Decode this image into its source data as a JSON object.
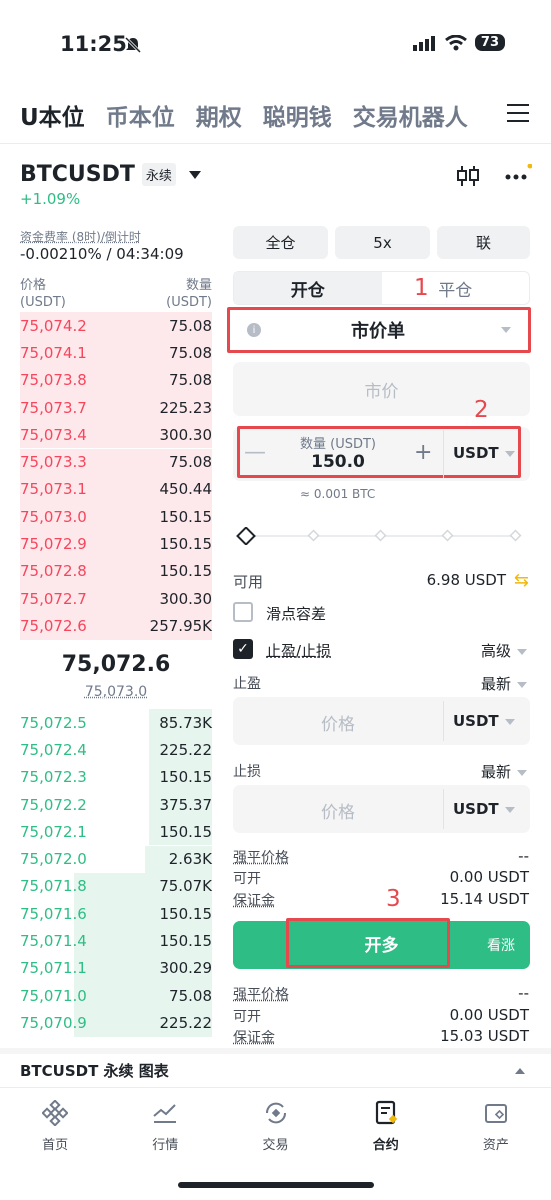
{
  "status": {
    "time": "11:25",
    "battery": "73"
  },
  "top_tabs": [
    "U本位",
    "币本位",
    "期权",
    "聪明钱",
    "交易机器人"
  ],
  "symbol": {
    "name": "BTCUSDT",
    "tag": "永续",
    "change": "+1.09%"
  },
  "funding": {
    "label": "资金费率 (8时)/倒计时",
    "value": "-0.00210% / 04:34:09"
  },
  "orderbook": {
    "price_header": "价格",
    "price_unit": "(USDT)",
    "qty_header": "数量",
    "qty_unit": "(USDT)",
    "asks": [
      {
        "price": "75,074.2",
        "qty": "75.08",
        "depth": 1.0
      },
      {
        "price": "75,074.1",
        "qty": "75.08",
        "depth": 1.0
      },
      {
        "price": "75,073.8",
        "qty": "75.08",
        "depth": 1.0
      },
      {
        "price": "75,073.7",
        "qty": "225.23",
        "depth": 1.0
      },
      {
        "price": "75,073.4",
        "qty": "300.30",
        "depth": 1.0
      },
      {
        "price": "75,073.3",
        "qty": "75.08",
        "depth": 1.0
      },
      {
        "price": "75,073.1",
        "qty": "450.44",
        "depth": 1.0
      },
      {
        "price": "75,073.0",
        "qty": "150.15",
        "depth": 1.0
      },
      {
        "price": "75,072.9",
        "qty": "150.15",
        "depth": 1.0
      },
      {
        "price": "75,072.8",
        "qty": "150.15",
        "depth": 1.0
      },
      {
        "price": "75,072.7",
        "qty": "300.30",
        "depth": 1.0
      },
      {
        "price": "75,072.6",
        "qty": "257.95K",
        "depth": 1.0
      }
    ],
    "mid_price": "75,072.6",
    "mark_price": "75,073.0",
    "bids": [
      {
        "price": "75,072.5",
        "qty": "85.73K",
        "depth": 0.33
      },
      {
        "price": "75,072.4",
        "qty": "225.22",
        "depth": 0.33
      },
      {
        "price": "75,072.3",
        "qty": "150.15",
        "depth": 0.33
      },
      {
        "price": "75,072.2",
        "qty": "375.37",
        "depth": 0.33
      },
      {
        "price": "75,072.1",
        "qty": "150.15",
        "depth": 0.33
      },
      {
        "price": "75,072.0",
        "qty": "2.63K",
        "depth": 0.35
      },
      {
        "price": "75,071.8",
        "qty": "75.07K",
        "depth": 0.72
      },
      {
        "price": "75,071.6",
        "qty": "150.15",
        "depth": 0.72
      },
      {
        "price": "75,071.4",
        "qty": "150.15",
        "depth": 0.72
      },
      {
        "price": "75,071.1",
        "qty": "300.29",
        "depth": 0.72
      },
      {
        "price": "75,071.0",
        "qty": "75.08",
        "depth": 0.72
      },
      {
        "price": "75,070.9",
        "qty": "225.22",
        "depth": 0.72
      }
    ]
  },
  "margin_buttons": {
    "cross": "全仓",
    "leverage": "5x",
    "mode": "联"
  },
  "position_tabs": {
    "open": "开仓",
    "close": "平仓"
  },
  "annotations": [
    "1",
    "2",
    "3"
  ],
  "order_type": "市价单",
  "market_price": "市价",
  "quantity": {
    "label": "数量 (USDT)",
    "value": "150.0",
    "unit": "USDT",
    "minus": "—",
    "plus": "+",
    "approx": "≈ 0.001 BTC"
  },
  "available": {
    "label": "可用",
    "value": "6.98 USDT"
  },
  "slippage": "滑点容差",
  "tpsl": {
    "label": "止盈/止损",
    "advanced": "高级"
  },
  "take_profit": {
    "label": "止盈",
    "mode": "最新",
    "placeholder": "价格",
    "unit": "USDT"
  },
  "stop_loss": {
    "label": "止损",
    "mode": "最新",
    "placeholder": "价格",
    "unit": "USDT"
  },
  "summary1": {
    "liq_label": "强平价格",
    "liq_value": "--",
    "open_label": "可开",
    "open_value": "0.00 USDT",
    "margin_label": "保证金",
    "margin_value": "15.14 USDT"
  },
  "long_button": {
    "label": "开多",
    "hint": "看涨"
  },
  "summary2": {
    "liq_label": "强平价格",
    "liq_value": "--",
    "open_label": "可开",
    "open_value": "0.00 USDT",
    "margin_label": "保证金",
    "margin_value": "15.03 USDT"
  },
  "chart_bar": "BTCUSDT 永续 图表",
  "nav": [
    "首页",
    "行情",
    "交易",
    "合约",
    "资产"
  ],
  "colors": {
    "green": "#2ebd85",
    "red": "#f6465d",
    "annotation": "#e5484d",
    "yellow": "#f0b90b"
  }
}
